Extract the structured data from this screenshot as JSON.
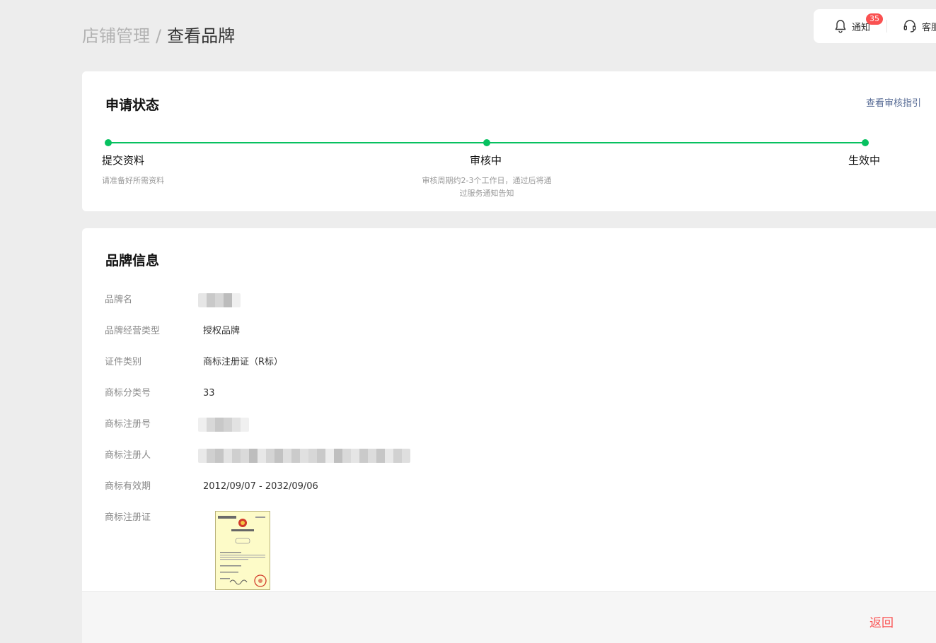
{
  "breadcrumb": {
    "parent": "店铺管理",
    "separator": "/",
    "current": "查看品牌"
  },
  "toolbar": {
    "notice_label": "通知",
    "notice_badge": "35",
    "service_label": "客服"
  },
  "status_card": {
    "title": "申请状态",
    "guide_link": "查看审核指引",
    "steps": [
      {
        "title": "提交资料",
        "desc": "请准备好所需资料"
      },
      {
        "title": "审核中",
        "desc_line1": "审核周期约2-3个工作日，通过后将通",
        "desc_line2": "过服务通知告知"
      },
      {
        "title": "生效中"
      }
    ]
  },
  "brand_card": {
    "title": "品牌信息",
    "fields": {
      "brand_name": {
        "label": "品牌名"
      },
      "business_type": {
        "label": "品牌经营类型",
        "value": "授权品牌"
      },
      "cert_type": {
        "label": "证件类别",
        "value": "商标注册证（R标）"
      },
      "class_no": {
        "label": "商标分类号",
        "value": "33"
      },
      "reg_no": {
        "label": "商标注册号"
      },
      "registrant": {
        "label": "商标注册人"
      },
      "validity": {
        "label": "商标有效期",
        "value": "2012/09/07 - 2032/09/06"
      },
      "certificate": {
        "label": "商标注册证"
      }
    }
  },
  "footer": {
    "back_label": "返回"
  },
  "colors": {
    "accent": "#07c160",
    "badge": "#fa5151",
    "link": "#576b95",
    "back": "#fa5151"
  }
}
